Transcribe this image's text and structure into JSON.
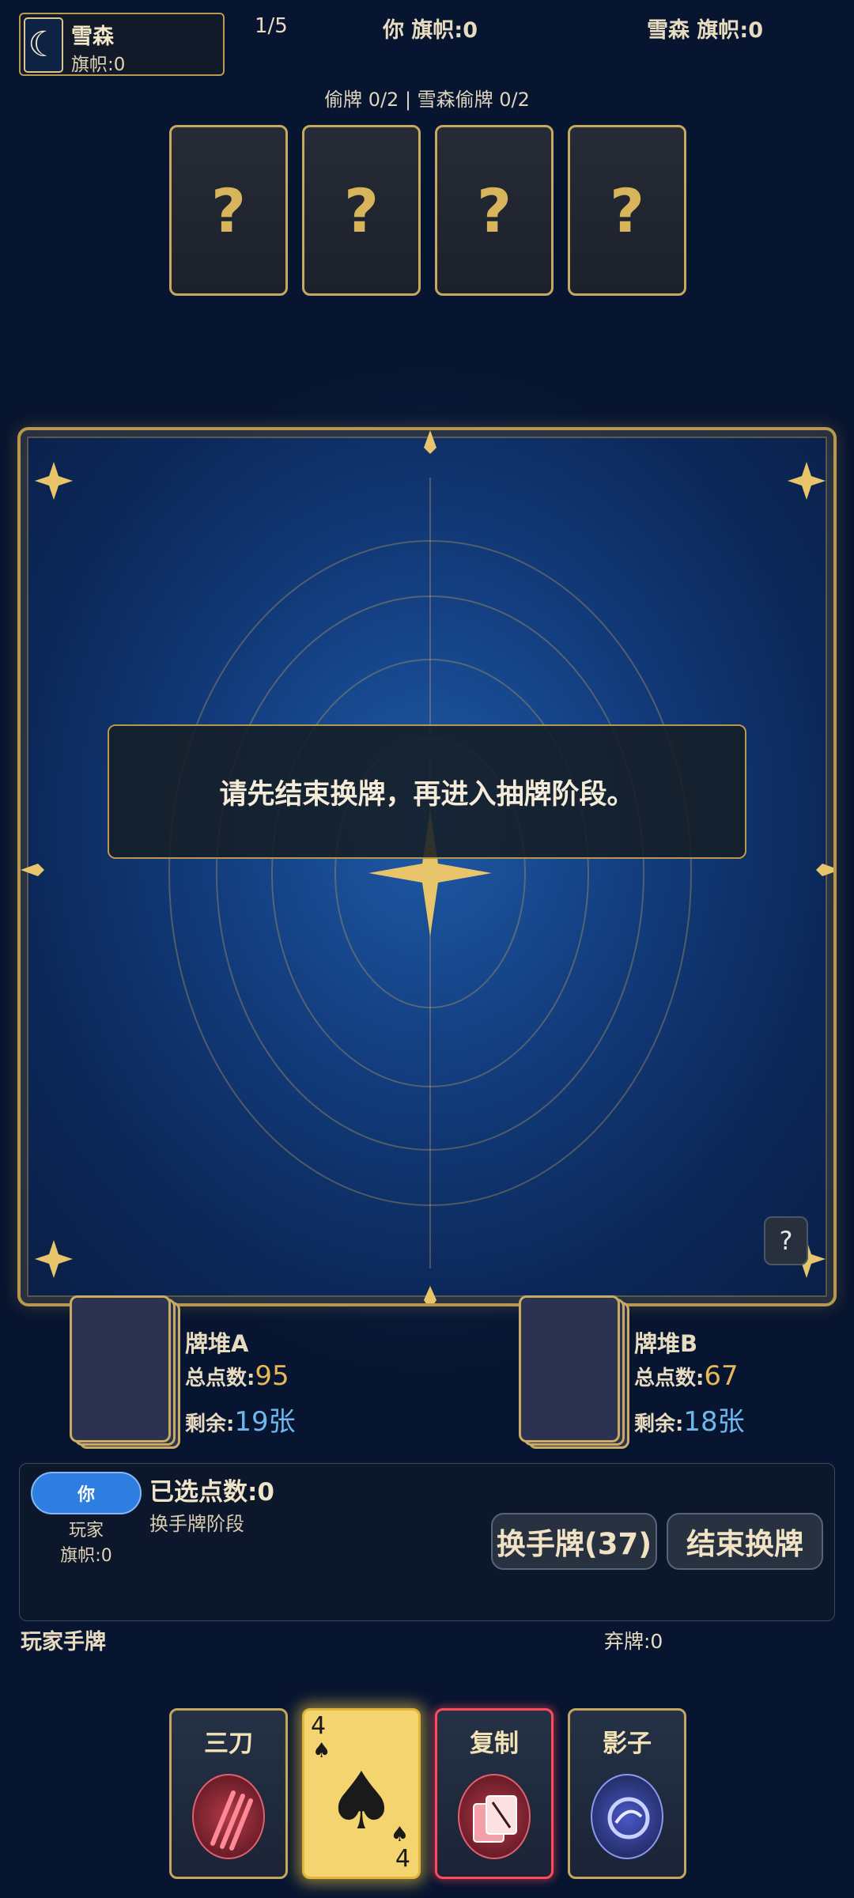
{
  "opponent": {
    "name": "雪森",
    "flags": "旗帜:0",
    "avatar_icon": "moon-icon"
  },
  "topbar": {
    "round": "1/5",
    "you_flags": "你 旗帜:0",
    "opponent_flags": "雪森 旗帜:0"
  },
  "steal_info": "偷牌 0/2 | 雪森偷牌 0/2",
  "opponent_cards": [
    "?",
    "?",
    "?",
    "?"
  ],
  "message": "请先结束换牌，再进入抽牌阶段。",
  "help_button": "?",
  "pile_a": {
    "name": "牌堆A",
    "total_label": "总点数:",
    "total": "95",
    "remain_label": "剩余:",
    "remain": "19张"
  },
  "pile_b": {
    "name": "牌堆B",
    "total_label": "总点数:",
    "total": "67",
    "remain_label": "剩余:",
    "remain": "18张"
  },
  "player": {
    "badge": "你",
    "role": "玩家",
    "flags": "旗帜:0",
    "selected_points": "已选点数:0",
    "phase": "换手牌阶段"
  },
  "buttons": {
    "swap_hand": "换手牌(37)",
    "end_swap": "结束换牌"
  },
  "hand_label": "玩家手牌",
  "discard": "弃牌:0",
  "hand": [
    {
      "type": "skill",
      "title": "三刀",
      "icon": "triple-slash-icon",
      "color": "#e0505a"
    },
    {
      "type": "playing",
      "rank": "4",
      "suit": "♠",
      "selected": true
    },
    {
      "type": "skill",
      "title": "复制",
      "icon": "copy-cards-icon",
      "color": "#e0505a",
      "highlighted": true
    },
    {
      "type": "skill",
      "title": "影子",
      "icon": "shadow-swirl-icon",
      "color": "#6a78e0"
    }
  ],
  "colors": {
    "gold": "#c7a860",
    "blue_value": "#6fb8ee",
    "orange_value": "#e8b858",
    "accent_blue": "#2e7de0"
  }
}
